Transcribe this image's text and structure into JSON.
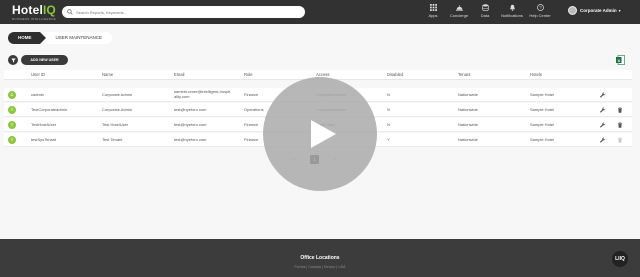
{
  "header": {
    "logo_word": "Hotel",
    "logo_iq": "IQ",
    "logo_tagline": "BUSINESS INTELLIGENCE",
    "search_placeholder": "Search Reports, Keywords...",
    "nav": [
      {
        "label": "Apps",
        "icon": "grid-icon"
      },
      {
        "label": "Concierge",
        "icon": "concierge-icon"
      },
      {
        "label": "Data",
        "icon": "database-icon"
      },
      {
        "label": "Notifications",
        "icon": "bell-icon"
      },
      {
        "label": "Help Center",
        "icon": "help-icon"
      }
    ],
    "user_name": "Corporate Admin"
  },
  "breadcrumb": {
    "home": "HOME",
    "current": "USER MAINTENANCE"
  },
  "toolbar": {
    "add_user_label": "ADD NEW USER"
  },
  "table": {
    "columns": [
      "User ID",
      "Name",
      "Email",
      "Role",
      "Access",
      "Disabled",
      "Tenant",
      "Hotels"
    ],
    "rows": [
      {
        "initial": "C",
        "user_id": "cadmin",
        "name": "Corporate Admin",
        "email_line1": "sameer.umer@intelligent-hospit",
        "email_line2": "ality.com",
        "role": "Finance",
        "access": "Corporate Admin",
        "disabled": "N",
        "tenant": "Nationwide",
        "hotels": "Sample Hotel",
        "deletable": false
      },
      {
        "initial": "T",
        "user_id": "TestCorporateadmin",
        "name": "Corporate Admin",
        "email_line1": "test@nyeforo.com",
        "email_line2": "",
        "role": "Operations",
        "access": "Corporate Admin",
        "disabled": "N",
        "tenant": "Nationwide",
        "hotels": "Sample Hotel",
        "deletable": true
      },
      {
        "initial": "T",
        "user_id": "TestHotelUser",
        "name": "Test HotelUser",
        "email_line1": "test@nyeforo.com",
        "email_line2": "",
        "role": "Finance",
        "access": "Hotel User",
        "disabled": "N",
        "tenant": "Nationwide",
        "hotels": "Sample Hotel",
        "deletable": true
      },
      {
        "initial": "T",
        "user_id": "testSysTenant",
        "name": "Test Tenant",
        "email_line1": "test@nyeforo.com",
        "email_line2": "",
        "role": "Finance",
        "access": "",
        "disabled": "Y",
        "tenant": "Nationwide",
        "hotels": "Sample Hotel",
        "deletable": false
      }
    ]
  },
  "pagination": {
    "first": "«",
    "prev": "‹",
    "current": "1",
    "next": "›",
    "last": "»"
  },
  "footer": {
    "title": "Office Locations",
    "subtitle": "Florida  |  Canada  |  Mexico  |  USA"
  },
  "badge": "LIIQ",
  "colors": {
    "accent": "#8dc63f",
    "header_bg": "#323232",
    "footer_bg": "#3c3c3c"
  }
}
